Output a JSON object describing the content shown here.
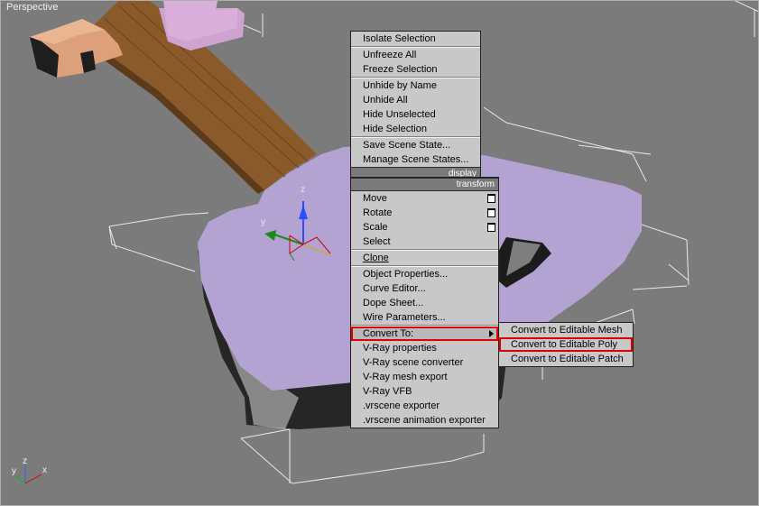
{
  "viewport": {
    "label": "Perspective"
  },
  "gizmo": {
    "z": "z",
    "y": "y"
  },
  "axis_tripod": {
    "z": "z",
    "y": "y",
    "x": "x"
  },
  "menu": {
    "group_display": [
      [
        "Isolate Selection"
      ],
      [
        "Unfreeze All",
        "Freeze Selection"
      ],
      [
        "Unhide by Name",
        "Unhide All",
        "Hide Unselected",
        "Hide Selection"
      ],
      [
        "Save Scene State...",
        "Manage Scene States..."
      ]
    ],
    "display_header": "display",
    "transform_header": "transform",
    "transform": {
      "move": "Move",
      "rotate": "Rotate",
      "scale": "Scale",
      "select": "Select",
      "clone": "Clone",
      "object_properties": "Object Properties...",
      "curve_editor": "Curve Editor...",
      "dope_sheet": "Dope Sheet...",
      "wire_parameters": "Wire Parameters...",
      "convert_to": "Convert To:",
      "vray_properties": "V-Ray properties",
      "vray_scene_converter": "V-Ray scene converter",
      "vray_mesh_export": "V-Ray mesh export",
      "vray_vfb": "V-Ray VFB",
      "vrscene_exporter": ".vrscene exporter",
      "vrscene_anim_exporter": ".vrscene animation exporter"
    }
  },
  "submenu": {
    "editable_mesh": "Convert to Editable Mesh",
    "editable_poly": "Convert to Editable Poly",
    "editable_patch": "Convert to Editable Patch"
  },
  "colors": {
    "viewport_bg": "#7b7b7b",
    "guitar_body": "#b3a3d3",
    "neck_wood": "#8b5a2b",
    "headstock": "#dca07a",
    "highlight": "#e00000",
    "menu_bg": "#c8c8c8"
  }
}
